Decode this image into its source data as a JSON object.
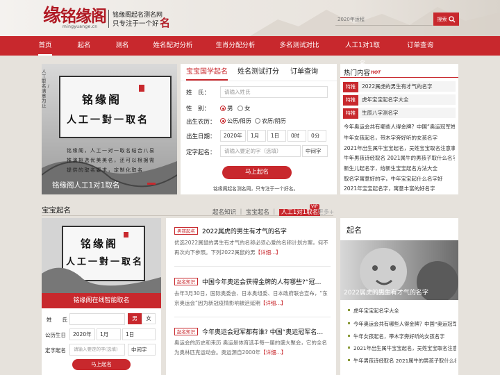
{
  "header": {
    "logo_mark": "缘铭缘阁",
    "logo_sub": "mingyuange.cn",
    "slogan_line1": "铭缘阁起名测名网",
    "slogan_line2": "只专注于一个好",
    "slogan_mark": "名",
    "search_placeholder": "2020年运程",
    "search_button": "搜索"
  },
  "nav": {
    "items": [
      "首页",
      "起名",
      "测名",
      "姓名配对分析",
      "生肖分配分析",
      "多名测试对比",
      "人工1对1取名",
      "订单查询"
    ]
  },
  "banner": {
    "caption": "铭缘阁人工1对1取名",
    "title": "铭缘阁",
    "subtitle": "人工一對一取名",
    "side_text": "人工取名 / 满意为止",
    "body": "铭缘阁，人工一对一取名结合八易推演挑选优美美名，还可以根据需提供的取名要求，定制化取名"
  },
  "form1": {
    "tabs": [
      "宝宝国学起名",
      "姓名测试打分",
      "订单查询"
    ],
    "surname_label": "姓　氏：",
    "surname_placeholder": "请输入姓氏",
    "gender_label": "性　别：",
    "gender_male": "男",
    "gender_female": "女",
    "calendar_label": "出生农历：",
    "calendar_solar": "公历/阳历",
    "calendar_lunar": "农历/阴历",
    "date_label": "出生日期：",
    "year": "2020年",
    "month": "1月",
    "day": "1日",
    "hour": "0时",
    "minute": "0分",
    "fixed_label": "定字起名：",
    "fixed_placeholder": "请输入要定的字（选填）",
    "fixed_pos": "中间字",
    "submit": "马上起名",
    "note": "铭缘阁起名测名网，只专注于一个好名。"
  },
  "hot": {
    "title": "热门内容",
    "hot_tag": "HOT",
    "badge": "特推",
    "featured": [
      "2022属虎的男生有才气的名字",
      "虎年宝宝起名字大全",
      "生辰八字测名字"
    ],
    "links": [
      "今年奥运会共有哪些人得金牌？中国“奥运冠军姓…",
      "牛年女孩起名，带木字旁好听的女孩名字",
      "2021年出生属牛宝宝起名，吴姓宝宝取名注意事…",
      "牛年男孩诗经取名 2021属牛的男孩子取什么名字",
      "新生儿起名字，给新生宝宝起名方法大全",
      "取名字寓意好的字，牛年宝宝起什么名字好",
      "2021年宝宝起名字，寓意丰富的好名字"
    ]
  },
  "section2": {
    "title": "宝宝起名",
    "crumbs": [
      "起名知识",
      "宝宝起名",
      "人工1对1取名"
    ],
    "vip": "VIP",
    "more": "更多+"
  },
  "form2": {
    "title": "铭缘阁在线智能取名",
    "surname_label": "姓　　氏",
    "gender_male": "男",
    "gender_female": "女",
    "date_label": "公历生日",
    "year": "2020年",
    "month": "1月",
    "day": "1日",
    "fixed_label": "定字起名",
    "fixed_placeholder": "请输入要定的字(选填)",
    "fixed_pos": "中间字",
    "submit": "马上起名"
  },
  "articles": [
    {
      "tag": "男孩起名",
      "title": "2022属虎的男生有才气的名字",
      "desc": "优选2022属鼠的男生有才气的名称必须心爱的名称计划方案，何不再次向下参照。下列2022属鼠的男",
      "more": "【详细...】"
    },
    {
      "tag": "起名知识",
      "title": "中国今年奥运会获得金牌的人有哪些?“冠…",
      "desc": "去年3月30日，国际奥委会、日本奥组委、日本政府联合宣布，“东京奥运会”因为新冠疫情影响被迫延期",
      "more": "【详细...】"
    },
    {
      "tag": "起名知识",
      "title": "今年奥运会冠军都有谁? 中国“奥运冠军名…",
      "desc": "奥运会的历史和来历 奥运是体育选手每一届的盛大聚会，它的全名为奥林匹克运动会。奥运源自2000年",
      "more": "【详细...】"
    }
  ],
  "side": {
    "title": "起名",
    "image_caption": "2022属虎的男生有才气的名字",
    "links": [
      "虎年宝宝起名字大全",
      "今年奥运会共有哪些人得金牌？中国“奥运冠军",
      "牛年女孩起名，带木字旁好听的女孩名字",
      "2021年出生属牛宝宝起名，吴姓宝宝取名注意",
      "牛年男孩诗经取名 2021属牛的男孩子取什么名"
    ]
  },
  "colors": {
    "brand": "#c8282d",
    "accent_green": "#8a9a3a"
  }
}
